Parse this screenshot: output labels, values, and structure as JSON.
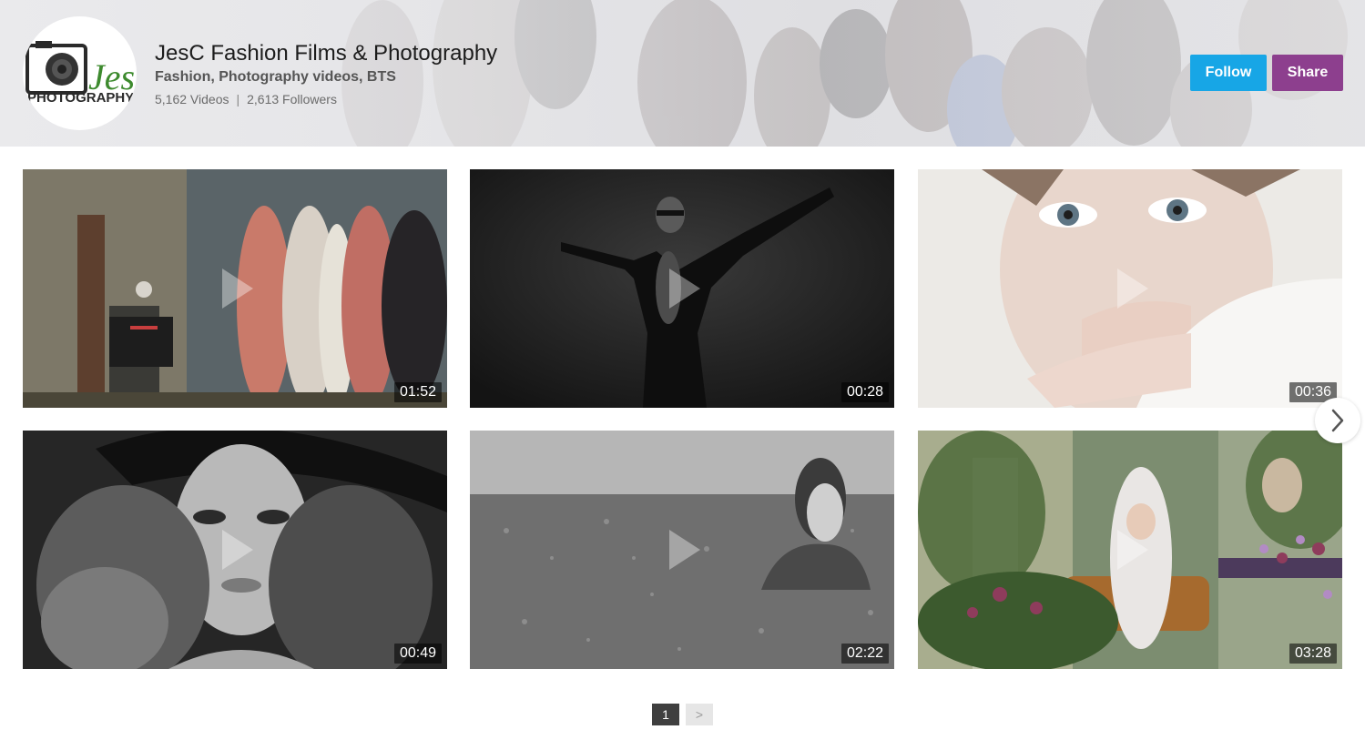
{
  "channel": {
    "name": "JesC Fashion Films & Photography",
    "tags": "Fashion, Photography videos, BTS",
    "videos_count": "5,162 Videos",
    "stats_separator": "|",
    "followers_count": "2,613 Followers",
    "logo_text": "JesC",
    "logo_subtext": "PHOTOGRAPHY"
  },
  "actions": {
    "follow_label": "Follow",
    "share_label": "Share"
  },
  "colors": {
    "follow": "#17a6e6",
    "share": "#8d3f8e",
    "logo_green": "#3d8a2e"
  },
  "videos": [
    {
      "duration": "01:52"
    },
    {
      "duration": "00:28"
    },
    {
      "duration": "00:36"
    },
    {
      "duration": "00:49"
    },
    {
      "duration": "02:22"
    },
    {
      "duration": "03:28"
    }
  ],
  "carousel": {
    "next_icon": "chevron-right-icon"
  },
  "pagination": {
    "current_page": "1",
    "next_label": ">"
  }
}
